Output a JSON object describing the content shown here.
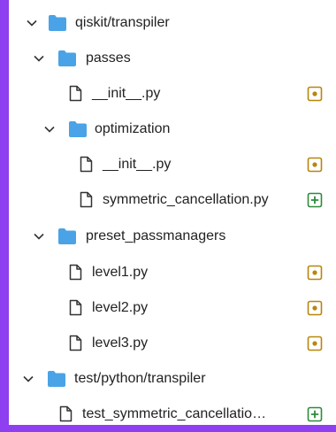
{
  "colors": {
    "frame": "#8e3ff0",
    "panel": "#ffffff",
    "folder": "#4aa3e6",
    "modified": "#b8860b",
    "added": "#2e8b3a",
    "text": "#222222"
  },
  "tree": {
    "items": [
      {
        "label": "qiskit/transpiler",
        "kind": "folder",
        "icon": "folder-icon",
        "expanded": true
      },
      {
        "label": "passes",
        "kind": "folder",
        "icon": "folder-icon",
        "expanded": true
      },
      {
        "label": "__init__.py",
        "kind": "file",
        "icon": "file-icon",
        "status": "modified",
        "status_icon": "modified-dot-icon"
      },
      {
        "label": "optimization",
        "kind": "folder",
        "icon": "folder-icon",
        "expanded": true
      },
      {
        "label": "__init__.py",
        "kind": "file",
        "icon": "file-icon",
        "status": "modified",
        "status_icon": "modified-dot-icon"
      },
      {
        "label": "symmetric_cancellation.py",
        "kind": "file",
        "icon": "file-icon",
        "status": "added",
        "status_icon": "added-plus-icon"
      },
      {
        "label": "preset_passmanagers",
        "kind": "folder",
        "icon": "folder-icon",
        "expanded": true
      },
      {
        "label": "level1.py",
        "kind": "file",
        "icon": "file-icon",
        "status": "modified",
        "status_icon": "modified-dot-icon"
      },
      {
        "label": "level2.py",
        "kind": "file",
        "icon": "file-icon",
        "status": "modified",
        "status_icon": "modified-dot-icon"
      },
      {
        "label": "level3.py",
        "kind": "file",
        "icon": "file-icon",
        "status": "modified",
        "status_icon": "modified-dot-icon"
      },
      {
        "label": "test/python/transpiler",
        "kind": "folder",
        "icon": "folder-icon",
        "expanded": true
      },
      {
        "label": "test_symmetric_cancellatio…",
        "kind": "file",
        "icon": "file-icon",
        "status": "added",
        "status_icon": "added-plus-icon"
      }
    ]
  }
}
